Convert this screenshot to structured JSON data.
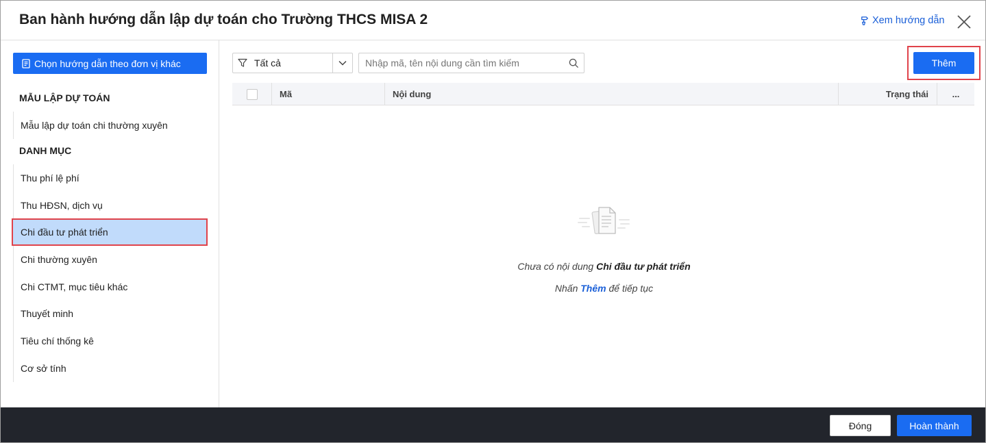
{
  "header": {
    "title": "Ban hành hướng dẫn lập dự toán cho Trường THCS MISA 2",
    "help_label": "Xem hướng dẫn"
  },
  "sidebar": {
    "choose_button_label": "Chọn hướng dẫn theo đơn vị khác",
    "sections": [
      {
        "title": "MẪU LẬP DỰ TOÁN",
        "items": [
          {
            "label": "Mẫu lập dự toán chi thường xuyên"
          }
        ]
      },
      {
        "title": "DANH MỤC",
        "items": [
          {
            "label": "Thu phí lệ phí"
          },
          {
            "label": "Thu HĐSN, dịch vụ"
          },
          {
            "label": "Chi đầu tư phát triển",
            "active": true
          },
          {
            "label": "Chi thường xuyên"
          },
          {
            "label": "Chi CTMT, mục tiêu khác"
          },
          {
            "label": "Thuyết minh"
          },
          {
            "label": "Tiêu chí thống kê"
          },
          {
            "label": "Cơ sở tính"
          }
        ]
      }
    ]
  },
  "toolbar": {
    "filter_value": "Tất cả",
    "search_placeholder": "Nhập mã, tên nội dung cần tìm kiếm",
    "add_label": "Thêm"
  },
  "table": {
    "columns": {
      "code": "Mã",
      "content": "Nội dung",
      "status": "Trạng thái",
      "more": "..."
    },
    "rows": []
  },
  "empty_state": {
    "prefix": "Chưa có nội dung",
    "category": "Chi đầu tư phát triển",
    "hint_prefix": "Nhấn",
    "hint_link": "Thêm",
    "hint_suffix": "để tiếp tục"
  },
  "footer": {
    "close_label": "Đóng",
    "done_label": "Hoàn thành"
  },
  "colors": {
    "primary": "#1a6cf2",
    "highlight": "#e0424a",
    "active_item": "#c1dbfb",
    "footer": "#22252c"
  },
  "icons": [
    "filter-icon",
    "chevron-down-icon",
    "search-icon",
    "document-icon",
    "close-icon",
    "help-pointer-icon",
    "empty-documents-icon"
  ]
}
